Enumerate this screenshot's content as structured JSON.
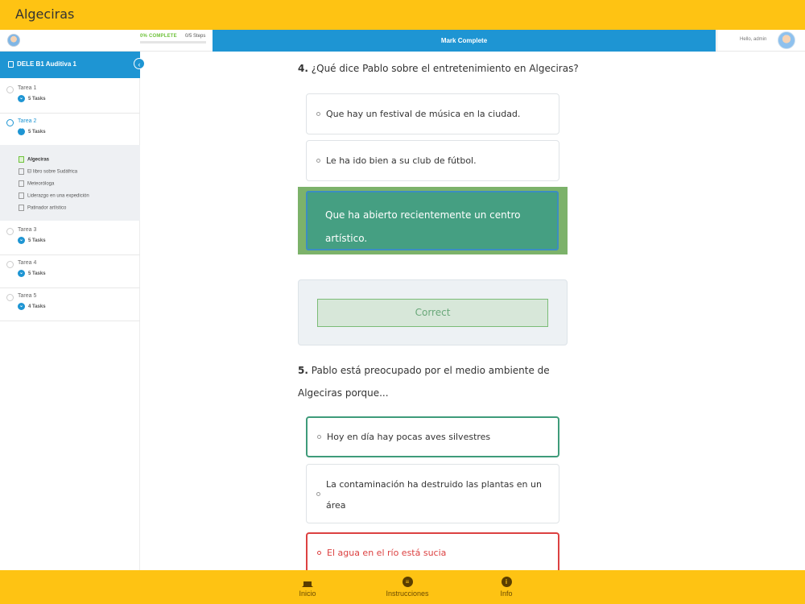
{
  "app": {
    "title": "Algeciras"
  },
  "progress": {
    "percent_label": "0% COMPLETE",
    "steps": "0/5 Steps",
    "fraction": 0.0
  },
  "header": {
    "mark_complete": "Mark Complete",
    "greeting": "Hello, admin"
  },
  "sidebar": {
    "course_title": "DELE B1 Auditiva 1",
    "lessons": [
      {
        "name": "Tarea 1",
        "tasks": "5 Tasks"
      },
      {
        "name": "Tarea 2",
        "tasks": "5 Tasks"
      },
      {
        "name": "Tarea 3",
        "tasks": "5 Tasks"
      },
      {
        "name": "Tarea 4",
        "tasks": "5 Tasks"
      },
      {
        "name": "Tarea 5",
        "tasks": "4 Tasks"
      }
    ],
    "topics": [
      "Algeciras",
      "El libro sobre Sudáfrica",
      "Meteoróloga",
      "Liderazgo en una expedición",
      "Patinador artístico"
    ]
  },
  "questions": [
    {
      "number": "4.",
      "text": "¿Qué dice Pablo sobre el entretenimiento en Algeciras?",
      "options": [
        "Que hay un festival de música en la ciudad.",
        "Le ha ido bien a su club de fútbol.",
        "Que ha abierto recientemente un centro artístico."
      ],
      "feedback": "Correct"
    },
    {
      "number": "5.",
      "text_line1": "Pablo está preocupado por el medio ambiente de",
      "text_line2": "Algeciras porque...",
      "options": [
        "Hoy en día hay pocas aves silvestres",
        "La contaminación ha destruido las plantas en un área",
        "El agua en el río está sucia"
      ]
    }
  ],
  "bottom_nav": [
    {
      "label": "Inicio",
      "icon": "home-icon"
    },
    {
      "label": "Instrucciones",
      "icon": "list-icon"
    },
    {
      "label": "Info",
      "icon": "info-icon"
    }
  ],
  "colors": {
    "accent_yellow": "#fec313",
    "accent_blue": "#1e95d3",
    "correct_green": "#459f82",
    "wrong_red": "#dc4141"
  }
}
